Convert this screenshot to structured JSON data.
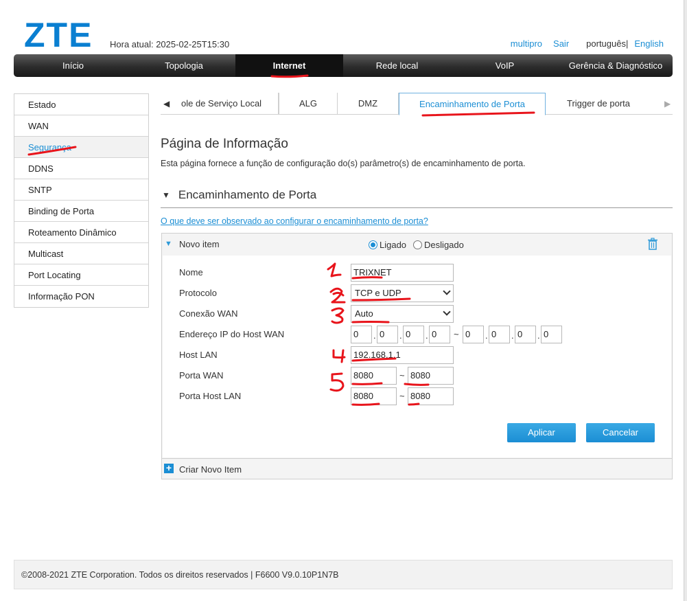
{
  "header": {
    "logo": "ZTE",
    "current_time": "Hora atual: 2025-02-25T15:30",
    "user": "multipro",
    "logout": "Sair",
    "lang_current": "português|",
    "lang_other": "English"
  },
  "nav": {
    "items": [
      "Início",
      "Topologia",
      "Internet",
      "Rede local",
      "VoIP",
      "Gerência & Diagnóstico"
    ],
    "active": "Internet"
  },
  "sidebar": {
    "items": [
      "Estado",
      "WAN",
      "Segurança",
      "DDNS",
      "SNTP",
      "Binding de Porta",
      "Roteamento Dinâmico",
      "Multicast",
      "Port Locating",
      "Informação PON"
    ],
    "active": "Segurança"
  },
  "subtabs": {
    "left_arrow": "◀",
    "right_arrow": "▶",
    "items": [
      "ole de Serviço Local",
      "ALG",
      "DMZ",
      "Encaminhamento de Porta",
      "Trigger de porta"
    ],
    "active": "Encaminhamento de Porta"
  },
  "page": {
    "title": "Página de Informação",
    "description": "Esta página fornece a função de configuração do(s) parâmetro(s) de encaminhamento de porta.",
    "section_title": "Encaminhamento de Porta",
    "help_link": "O que deve ser observado ao configurar o encaminhamento de porta?"
  },
  "item": {
    "title": "Novo item",
    "radio_on": "Ligado",
    "radio_off": "Desligado",
    "state": "Ligado",
    "fields": {
      "name_label": "Nome",
      "name_value": "TRIXNET",
      "protocol_label": "Protocolo",
      "protocol_value": "TCP e UDP",
      "wan_conn_label": "Conexão WAN",
      "wan_conn_value": "Auto",
      "wan_host_ip_label": "Endereço IP do Host WAN",
      "wan_host_ip_start": [
        "0",
        "0",
        "0",
        "0"
      ],
      "wan_host_ip_end": [
        "0",
        "0",
        "0",
        "0"
      ],
      "range_sep": "~",
      "lan_host_label": "Host LAN",
      "lan_host_value": "192.168.1.1",
      "wan_port_label": "Porta WAN",
      "wan_port_start": "8080",
      "wan_port_end": "8080",
      "lan_port_label": "Porta Host LAN",
      "lan_port_start": "8080",
      "lan_port_end": "8080"
    },
    "apply": "Aplicar",
    "cancel": "Cancelar",
    "create_new": "Criar Novo Item"
  },
  "footer": {
    "text": "©2008-2021 ZTE Corporation. Todos os direitos reservados  |   F6600 V9.0.10P1N7B"
  },
  "annotations": {
    "color": "#e8141b",
    "numbers": [
      "1",
      "2",
      "3",
      "4",
      "5"
    ]
  },
  "colors": {
    "accent": "#1b8ed4",
    "nav_bg": "#2c2c2c",
    "logo": "#0a7fd1"
  }
}
